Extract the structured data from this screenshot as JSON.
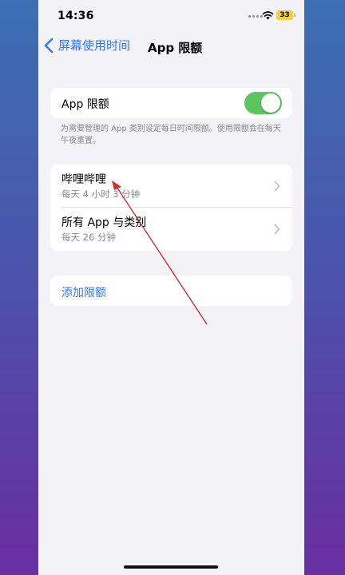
{
  "status_bar": {
    "time": "14:36",
    "battery": "33"
  },
  "nav": {
    "back_label": "屏幕使用时间",
    "title": "App 限额"
  },
  "limit_toggle": {
    "label": "App 限额",
    "enabled": true
  },
  "footnote": "为需要管理的 App 类别设定每日时间限额。使用限额会在每天午夜重置。",
  "limits": [
    {
      "title": "哔哩哔哩",
      "subtitle": "每天 4 小时 3 分钟"
    },
    {
      "title": "所有 App 与类别",
      "subtitle": "每天 26 分钟"
    }
  ],
  "add_limit_label": "添加限额",
  "colors": {
    "accent": "#3478f6",
    "toggle_on": "#5ec45f",
    "annotation": "#c8322c"
  }
}
